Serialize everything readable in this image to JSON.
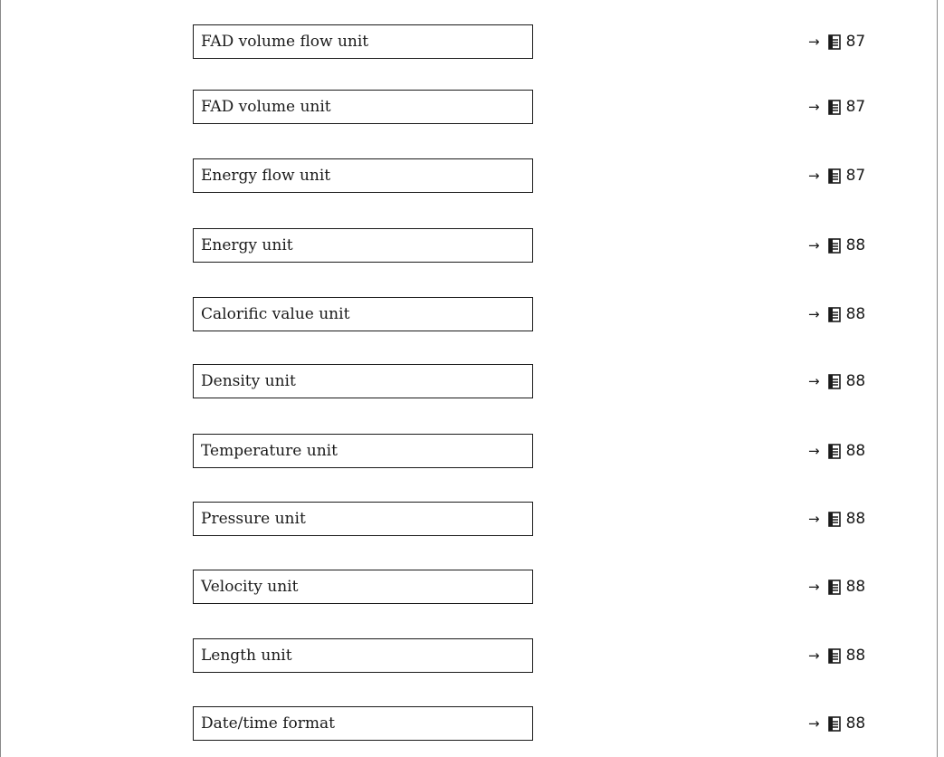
{
  "parameters": [
    {
      "label": "FAD volume flow unit",
      "arrow": "→",
      "page": "87"
    },
    {
      "label": "FAD volume unit",
      "arrow": "→",
      "page": "87"
    },
    {
      "label": "Energy flow unit",
      "arrow": "→",
      "page": "87"
    },
    {
      "label": "Energy unit",
      "arrow": "→",
      "page": "88"
    },
    {
      "label": "Calorific value unit",
      "arrow": "→",
      "page": "88"
    },
    {
      "label": "Density unit",
      "arrow": "→",
      "page": "88"
    },
    {
      "label": "Temperature unit",
      "arrow": "→",
      "page": "88"
    },
    {
      "label": "Pressure unit",
      "arrow": "→",
      "page": "88"
    },
    {
      "label": "Velocity unit",
      "arrow": "→",
      "page": "88"
    },
    {
      "label": "Length unit",
      "arrow": "→",
      "page": "88"
    },
    {
      "label": "Date/time format",
      "arrow": "→",
      "page": "88"
    }
  ],
  "icons": {
    "reference": "arrow-right-icon",
    "page": "book-icon"
  },
  "colors": {
    "text": "#1a1a1a",
    "border": "#1a1a1a",
    "frame": "#8a8a8a",
    "background": "#ffffff"
  }
}
